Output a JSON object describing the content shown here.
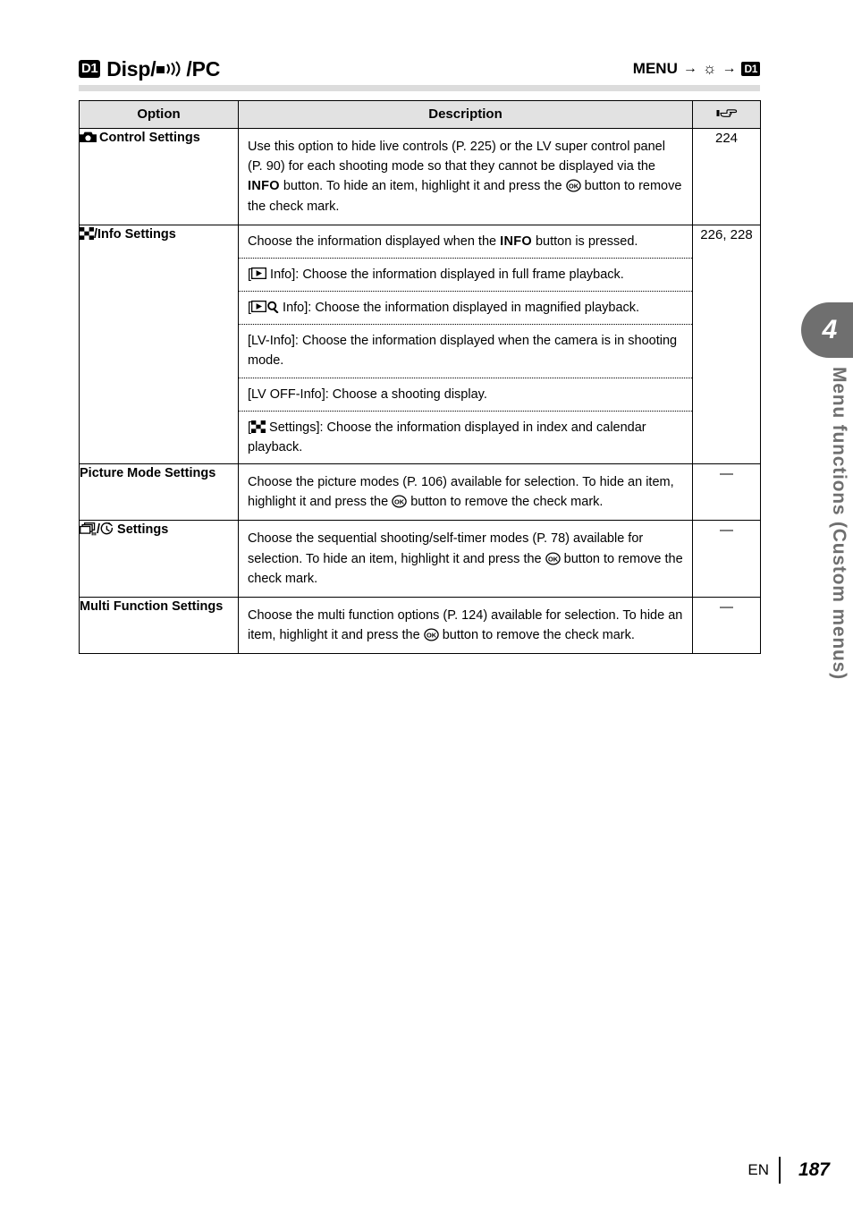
{
  "header": {
    "badge": "D1",
    "title": "Disp/",
    "title_suffix": "/PC",
    "menu_label": "MENU",
    "arrow": "→",
    "gear_icon": "gear-icon",
    "menu_target_badge": "D1"
  },
  "table": {
    "columns": {
      "option": "Option",
      "description": "Description",
      "reference": "pointing-hand-icon"
    },
    "rows": [
      {
        "option_icon": "camera-icon",
        "option_label": "Control Settings",
        "description_blocks": [
          {
            "parts": [
              {
                "text": "Use this option to hide live controls (P. 225) or the LV super control panel (P. 90) for each shooting mode so that they cannot be displayed via the "
              },
              {
                "bold": "INFO"
              },
              {
                "text": " button. To hide an item, highlight it and press the "
              },
              {
                "icon": "ok-button-icon"
              },
              {
                "text": " button to remove the check mark."
              }
            ]
          }
        ],
        "reference": "224"
      },
      {
        "option_icon": "index-checker-icon",
        "option_label": "/Info Settings",
        "description_blocks": [
          {
            "parts": [
              {
                "text": "Choose the information displayed when the "
              },
              {
                "bold": "INFO"
              },
              {
                "text": " button is pressed."
              }
            ]
          },
          {
            "parts": [
              {
                "text": "["
              },
              {
                "icon": "playback-icon"
              },
              {
                "text": " Info]: Choose the information displayed in full frame playback."
              }
            ]
          },
          {
            "parts": [
              {
                "text": "["
              },
              {
                "icon": "playback-icon"
              },
              {
                "icon": "magnify-icon"
              },
              {
                "text": " Info]: Choose the information displayed in magnified playback."
              }
            ]
          },
          {
            "parts": [
              {
                "text": "[LV-Info]: Choose the information displayed when the camera is in shooting mode."
              }
            ]
          },
          {
            "parts": [
              {
                "text": "[LV OFF-Info]: Choose a shooting display."
              }
            ]
          },
          {
            "parts": [
              {
                "text": "["
              },
              {
                "icon": "index-checker-icon"
              },
              {
                "text": " Settings]: Choose the information displayed in index and calendar playback."
              }
            ]
          }
        ],
        "reference": "226, 228"
      },
      {
        "option_icon": null,
        "option_label": "Picture Mode Settings",
        "description_blocks": [
          {
            "parts": [
              {
                "text": "Choose the picture modes (P. 106) available for selection. To hide an item, highlight it and press the "
              },
              {
                "icon": "ok-button-icon"
              },
              {
                "text": " button to remove the check mark."
              }
            ]
          }
        ],
        "reference": "—"
      },
      {
        "option_icon": "burst-timer-icon",
        "option_label": " Settings",
        "description_blocks": [
          {
            "parts": [
              {
                "text": "Choose the sequential shooting/self-timer modes (P. 78) available for selection. To hide an item, highlight it and press the "
              },
              {
                "icon": "ok-button-icon"
              },
              {
                "text": " button to remove the check mark."
              }
            ]
          }
        ],
        "reference": "—"
      },
      {
        "option_icon": null,
        "option_label": "Multi Function Settings",
        "description_blocks": [
          {
            "parts": [
              {
                "text": "Choose the multi function options (P. 124) available for selection. To hide an item, highlight it and press the "
              },
              {
                "icon": "ok-button-icon"
              },
              {
                "text": " button to remove the check mark."
              }
            ]
          }
        ],
        "reference": "—"
      }
    ]
  },
  "chapter": {
    "number": "4",
    "title": "Menu functions (Custom menus)"
  },
  "footer": {
    "language": "EN",
    "page": "187"
  },
  "colors": {
    "chapter_tab": "#6f6f6f",
    "header_fill": "#e2e2e2",
    "title_rule": "#dcdcdc"
  }
}
